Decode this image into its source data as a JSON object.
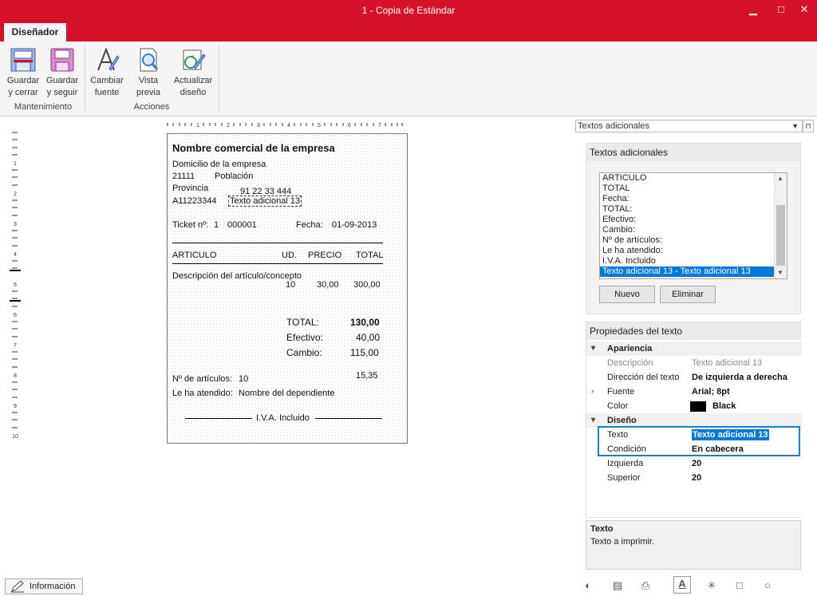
{
  "window": {
    "title": "1 - Copia de Estándar",
    "min": "▁",
    "max": "□",
    "close": "✕"
  },
  "ribbon": {
    "tab": "Diseñador",
    "buttons": [
      {
        "l1": "Guardar",
        "l2": "y cerrar"
      },
      {
        "l1": "Guardar",
        "l2": "y seguir"
      },
      {
        "l1": "Cambiar",
        "l2": "fuente"
      },
      {
        "l1": "Vista",
        "l2": "previa"
      },
      {
        "l1": "Actualizar",
        "l2": "diseño"
      }
    ],
    "groups": [
      "Mantenimiento",
      "Acciones"
    ]
  },
  "ruler": {
    "top": [
      "1",
      "2",
      "3",
      "4",
      "5",
      "6",
      "7"
    ],
    "left": [
      "1",
      "2",
      "3",
      "4",
      "5",
      "6",
      "7",
      "8",
      "9",
      "10"
    ]
  },
  "ticket": {
    "company": "Nombre  comercial de la empresa",
    "address": "Domicilio de la empresa",
    "zip": "21111",
    "city": "Población",
    "province": "Provincia",
    "phone": "91 22 33 444",
    "nif": "A11223344",
    "extra_text": "Texto adicional 13",
    "ticket_label": "Ticket nº:",
    "ticket_series": "1",
    "ticket_num": "000001",
    "date_label": "Fecha:",
    "date": "01-09-2013",
    "col_article": "ARTICULO",
    "col_units": "UD.",
    "col_price": "PRECIO",
    "col_total": "TOTAL",
    "item_desc": "Descripción del artículo/concepto",
    "item_units": "10",
    "item_price": "30,00",
    "item_total": "300,00",
    "total_label": "TOTAL:",
    "total_value": "130,00",
    "cash_label": "Efectivo:",
    "cash_value": "40,00",
    "change_label": "Cambio:",
    "change_value": "115,00",
    "nitems_label": "Nº de artículos:",
    "nitems_value": "10",
    "extra_num": "15,35",
    "served_label": "Le ha atendido:",
    "served_value": "Nombre del dependiente",
    "vat_note": "I.V.A. Incluido"
  },
  "panel": {
    "combo": "Textos adicionales",
    "pin": "⊓",
    "textos_header": "Textos adicionales",
    "list": [
      "ARTICULO",
      "TOTAL",
      "Fecha:",
      "TOTAL:",
      "Efectivo:",
      "Cambio:",
      "Nº de artículos:",
      "Le ha atendido:",
      "I.V.A. Incluido",
      "Texto adicional 13 - Texto adicional 13"
    ],
    "selected_index": 9,
    "btn_new": "Nuevo",
    "btn_delete": "Eliminar",
    "props_header": "Propiedades del texto",
    "props": {
      "cat_appearance": "Apariencia",
      "desc_label": "Descripción",
      "desc_value": "Texto adicional 13",
      "dir_label": "Dirección del texto",
      "dir_value": "De izquierda a derecha",
      "font_label": "Fuente",
      "font_value": "Arial; 8pt",
      "color_label": "Color",
      "color_value": "Black",
      "color_swatch": "#000000",
      "cat_design": "Diseño",
      "text_label": "Texto",
      "text_value": "Texto adicional 13",
      "cond_label": "Condición",
      "cond_value": "En cabecera",
      "left_label": "Izquierda",
      "left_value": "20",
      "top_label": "Superior",
      "top_value": "20"
    },
    "help_title": "Texto",
    "help_text": "Texto a imprimir."
  },
  "status": {
    "info": "Información"
  },
  "colors": {
    "accent": "#d6112a",
    "selection": "#0078d7"
  }
}
